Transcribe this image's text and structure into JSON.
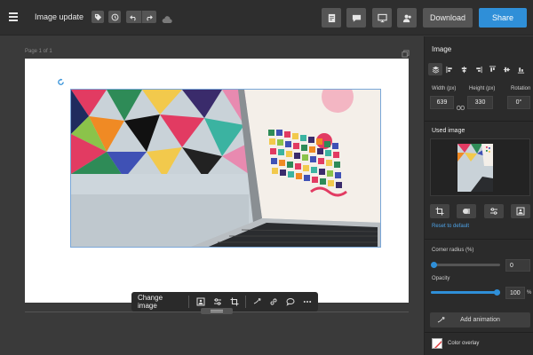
{
  "app": {
    "title": "Image update"
  },
  "topbar": {
    "download_label": "Download",
    "share_label": "Share",
    "icons": [
      "menu-icon",
      "tag-icon",
      "history-icon",
      "undo-icon",
      "redo-icon",
      "cloud-icon",
      "document-icon",
      "comment-icon",
      "present-icon",
      "collaborators-icon"
    ]
  },
  "canvas": {
    "page_label": "Page 1 of 1"
  },
  "float_toolbar": {
    "change_image_label": "Change image"
  },
  "panel": {
    "title": "Image",
    "width_label": "Width (px)",
    "height_label": "Height (px)",
    "rotation_label": "Rotation",
    "width_value": "639",
    "height_value": "330",
    "rotation_value": "0°",
    "used_image_label": "Used image",
    "reset_label": "Reset to default",
    "corner_radius_label": "Corner radius (%)",
    "corner_radius_value": "0",
    "opacity_label": "Opacity",
    "opacity_value": "100",
    "opacity_unit": "%",
    "add_animation_label": "Add animation",
    "color_overlay_label": "Color overlay"
  },
  "colors": {
    "accent": "#2f8fd8",
    "topbar_bg": "#2e2e2e",
    "panel_bg": "#2b2b2b",
    "canvas_bg": "#3a3a3a"
  },
  "sliders": {
    "corner_radius_fraction": 0.0,
    "opacity_fraction": 1.0
  }
}
